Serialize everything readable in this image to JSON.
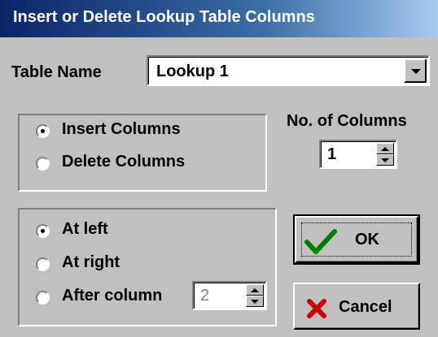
{
  "window": {
    "title": "Insert or Delete Lookup Table Columns"
  },
  "table": {
    "label": "Table Name",
    "value": "Lookup 1"
  },
  "action": {
    "options": [
      {
        "label": "Insert Columns",
        "selected": true
      },
      {
        "label": "Delete Columns",
        "selected": false
      }
    ]
  },
  "columns": {
    "label": "No. of Columns",
    "value": "1"
  },
  "position": {
    "options": [
      {
        "label": "At left",
        "selected": true
      },
      {
        "label": "At right",
        "selected": false
      },
      {
        "label": "After column",
        "selected": false
      }
    ],
    "after_value": "2"
  },
  "buttons": {
    "ok": "OK",
    "cancel": "Cancel"
  },
  "icons": {
    "ok": "checkmark-icon",
    "cancel": "x-icon",
    "ok_color": "#008000",
    "cancel_color": "#cc0000"
  }
}
